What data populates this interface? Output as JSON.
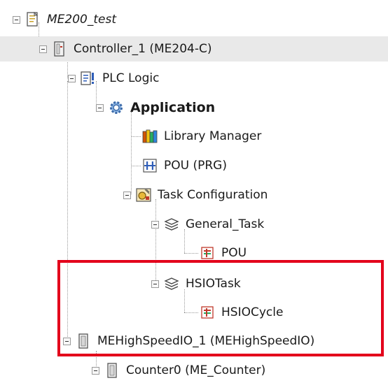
{
  "tree": {
    "root": {
      "label": "ME200_test",
      "icon": "project-icon"
    },
    "controller": {
      "label": "Controller_1 (ME204-C)",
      "icon": "controller-icon"
    },
    "plc_logic": {
      "label": "PLC Logic",
      "icon": "plc-logic-icon"
    },
    "application": {
      "label": "Application",
      "icon": "gear-icon"
    },
    "library_manager": {
      "label": "Library Manager",
      "icon": "library-books-icon"
    },
    "pou_prg": {
      "label": "POU (PRG)",
      "icon": "program-pou-icon"
    },
    "task_configuration": {
      "label": "Task Configuration",
      "icon": "task-configuration-icon"
    },
    "general_task": {
      "label": "General_Task",
      "icon": "task-stack-icon"
    },
    "pou_call": {
      "label": "POU",
      "icon": "program-call-icon"
    },
    "hsio_task": {
      "label": "HSIOTask",
      "icon": "task-stack-icon"
    },
    "hsio_cycle": {
      "label": "HSIOCycle",
      "icon": "program-call-icon"
    },
    "high_speed_io": {
      "label": "MEHighSpeedIO_1 (MEHighSpeedIO)",
      "icon": "device-module-icon"
    },
    "counter0": {
      "label": "Counter0 (ME_Counter)",
      "icon": "device-module-icon"
    }
  },
  "colors": {
    "highlight_border": "#e3001b",
    "selected_row": "#e9e9e9"
  }
}
